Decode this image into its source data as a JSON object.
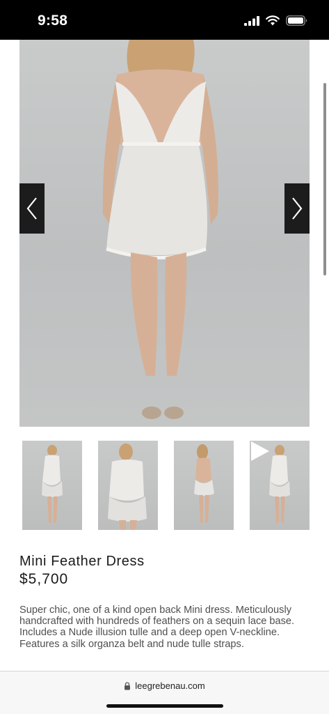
{
  "status_bar": {
    "time": "9:58",
    "icons": [
      "signal-icon",
      "wifi-icon",
      "battery-icon"
    ]
  },
  "gallery": {
    "hero_image": "mini-feather-dress-front",
    "prev_icon": "chevron-left-icon",
    "next_icon": "chevron-right-icon",
    "thumbnails": [
      {
        "name": "thumbnail-1",
        "view": "front"
      },
      {
        "name": "thumbnail-2",
        "view": "close-up"
      },
      {
        "name": "thumbnail-3",
        "view": "back"
      },
      {
        "name": "thumbnail-4",
        "view": "video",
        "icon": "play-icon"
      }
    ]
  },
  "product": {
    "title": "Mini Feather Dress",
    "price": "$5,700",
    "description": "Super chic, one of a kind open back Mini dress. Meticulously handcrafted with hundreds of feathers on a sequin lace base. Includes a Nude illusion tulle and a deep open V-neckline. Features a silk organza belt and nude tulle straps."
  },
  "browser": {
    "url": "leegrebenau.com",
    "lock_icon": "lock-icon"
  },
  "colors": {
    "background": "#ffffff",
    "status_bar": "#000000",
    "arrow_button": "#1c1c1c",
    "text": "#1a1a1a",
    "description_text": "#4f4f4f"
  }
}
